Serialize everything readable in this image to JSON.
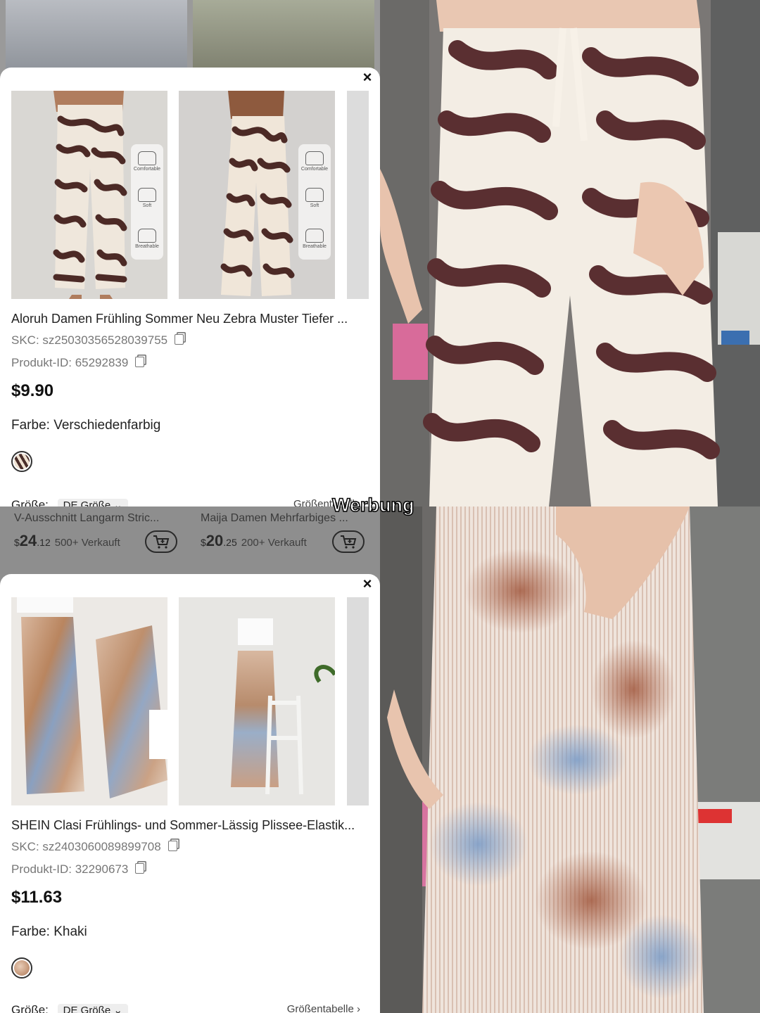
{
  "ad_label": "Werbung",
  "top_product": {
    "title": "Aloruh Damen Frühling Sommer Neu Zebra Muster Tiefer ...",
    "skc": "SKC: sz25030356528039755",
    "product_id": "Produkt-ID: 65292839",
    "price": "$9.90",
    "color_label": "Farbe:",
    "color_value": "Verschiedenfarbig",
    "size_label": "Größe:",
    "size_value": "DE Größe",
    "size_chart": "Größentabelle",
    "badges": [
      "Comfortable",
      "Soft",
      "Breathable"
    ],
    "colors": {
      "swatch": "#4a2e2a"
    }
  },
  "middle_strip": {
    "items": [
      {
        "title": "V-Ausschnitt Langarm Stric...",
        "price_currency": "$",
        "price_main": "24",
        "price_cents": ".12",
        "sold": "500+ Verkauft"
      },
      {
        "title": "Maija Damen Mehrfarbiges ...",
        "price_currency": "$",
        "price_main": "20",
        "price_cents": ".25",
        "sold": "200+ Verkauft"
      }
    ]
  },
  "bottom_product": {
    "title": "SHEIN Clasi Frühlings- und Sommer-Lässig Plissee-Elastik...",
    "skc": "SKC: sz2403060089899708",
    "product_id": "Produkt-ID: 32290673",
    "price": "$11.63",
    "color_label": "Farbe:",
    "color_value": "Khaki",
    "size_label": "Größe:",
    "size_value": "DE Größe",
    "size_chart": "Größentabelle",
    "colors": {
      "swatch": "#c9a48c"
    }
  }
}
